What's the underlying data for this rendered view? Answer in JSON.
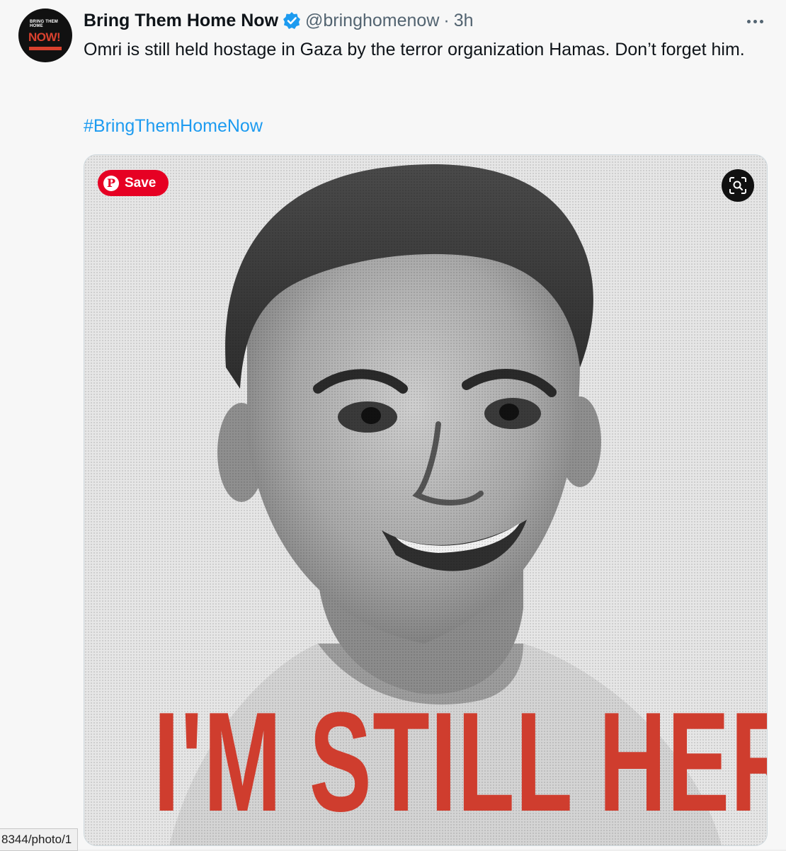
{
  "tweet": {
    "display_name": "Bring Them Home Now",
    "handle": "@bringhomenow",
    "separator": "·",
    "time": "3h",
    "text": "Omri is still held hostage in Gaza by the terror organization Hamas. Don’t forget him.",
    "hashtag": "#BringThemHomeNow",
    "avatar": {
      "small_text": "BRING THEM HOME",
      "big_text": "NOW!"
    }
  },
  "media": {
    "save_label": "Save",
    "pin_glyph": "P",
    "headline": "I'M STILL HERE"
  },
  "status_bar": {
    "url": "8344/photo/1"
  },
  "colors": {
    "accent": "#1d9bf0",
    "headline": "#cf3d2e",
    "pinterest": "#e60023"
  },
  "icons": [
    "verified-icon",
    "more-icon",
    "pinterest-icon",
    "lens-search-icon"
  ]
}
